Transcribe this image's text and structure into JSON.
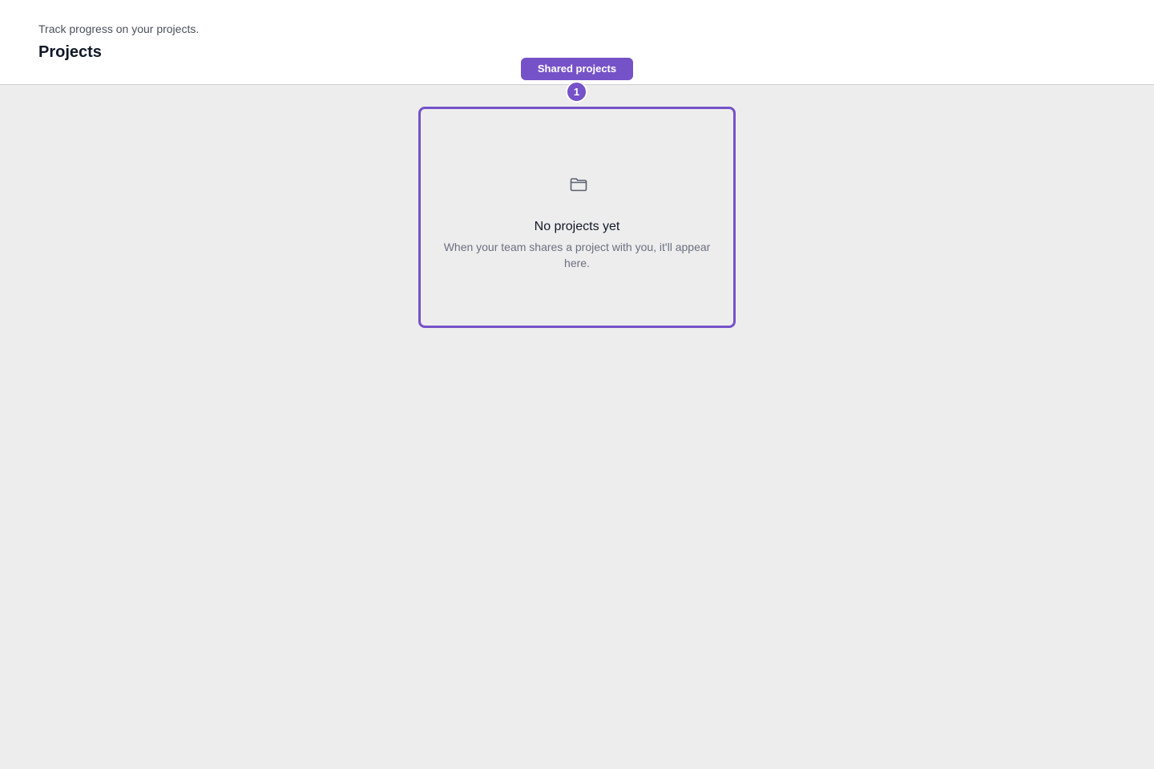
{
  "header": {
    "subtitle": "Track progress on your projects.",
    "title": "Projects"
  },
  "tab": {
    "label": "Shared projects",
    "step_number": "1"
  },
  "empty_state": {
    "icon": "folder-icon",
    "title": "No projects yet",
    "description": "When your team shares a project with you, it'll appear here."
  },
  "colors": {
    "accent": "#7652c8",
    "page_background": "#ededed",
    "header_background": "#ffffff",
    "title_text": "#111827",
    "muted_text": "#6b7080"
  }
}
